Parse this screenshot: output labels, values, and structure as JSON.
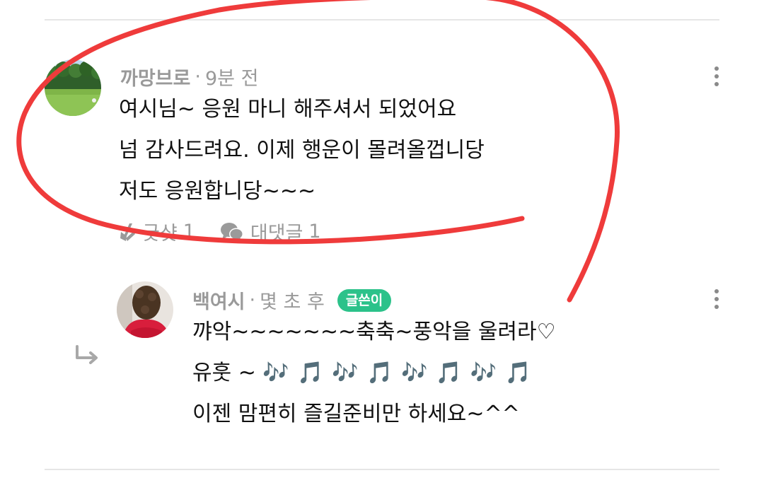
{
  "comment": {
    "author": "까망브로",
    "separator": "·",
    "time": "9분 전",
    "lines": [
      "여시님~ 응원 마니 해주셔서 되었어요",
      "넘 감사드려요. 이제 행운이 몰려올껍니당",
      "저도 응원합니당~~~"
    ],
    "likes_label": "굿샷",
    "likes_count": "1",
    "replies_label": "대댓글",
    "replies_count": "1"
  },
  "reply": {
    "author": "백여시",
    "separator": "·",
    "time": "몇 초 후",
    "badge": "글쓴이",
    "line1": "꺄악~~~~~~~축축~풍악을 울려라♡",
    "line2_text": "유훗 ~ ",
    "line2_notes": "🎶 🎵 🎶 🎵 🎶 🎵 🎶 🎵",
    "line3": "이젠 맘편히 즐길준비만 하세요~^^"
  },
  "colors": {
    "badge": "#2cc28a",
    "annotation": "#ef3b3b",
    "muted_text": "#9a9a9a",
    "divider": "#e6e6e6"
  },
  "icons": {
    "like": "golf-club-icon",
    "reply_count": "speech-bubbles-icon",
    "more": "more-vertical-icon",
    "reply_indicator": "reply-arrow-icon"
  }
}
